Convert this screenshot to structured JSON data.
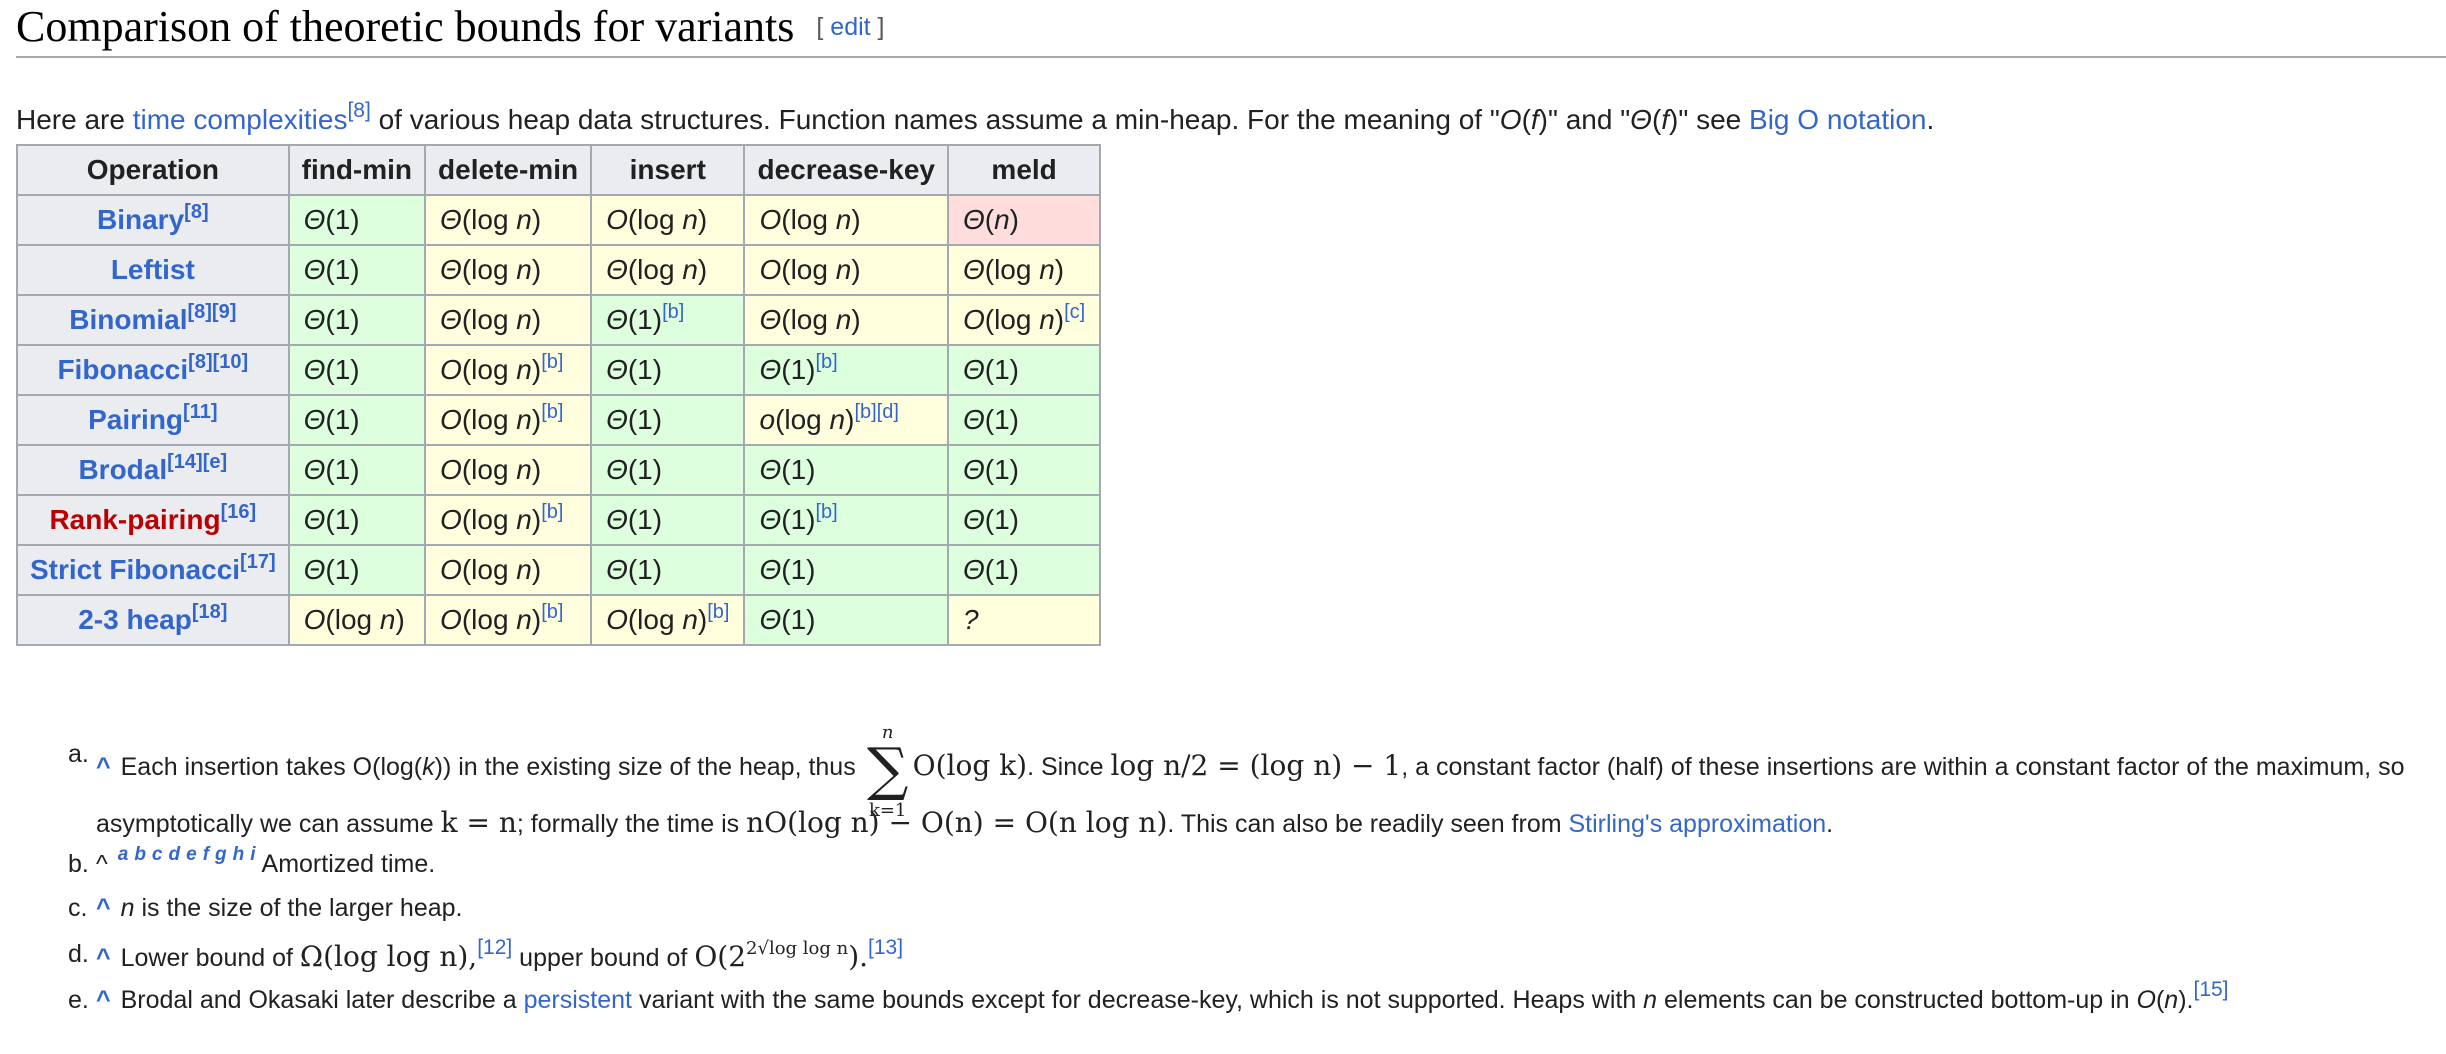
{
  "heading": {
    "title": "Comparison of theoretic bounds for variants",
    "edit_open": "[ ",
    "edit_label": "edit",
    "edit_close": " ]"
  },
  "intro": {
    "t1": "Here are ",
    "link1": "time complexities",
    "ref1": "[8]",
    "t2": " of various heap data structures. Function names assume a min-heap. For the meaning of \"",
    "o_f": "O",
    "paren_f1": "(",
    "f1": "f",
    "t3": ")\" and \"",
    "theta": "Θ",
    "paren_f2": "(",
    "f2": "f",
    "t4": ")\" see ",
    "link2": "Big O notation",
    "t5": "."
  },
  "table": {
    "headers": [
      "Operation",
      "find-min",
      "delete-min",
      "insert",
      "decrease-key",
      "meld"
    ],
    "rows": [
      {
        "name": "Binary",
        "refs": "[8]",
        "red": false,
        "cells": [
          [
            "Θ(1)",
            "",
            "good"
          ],
          [
            "Θ(log n)",
            "",
            "mid"
          ],
          [
            "O(log n)",
            "",
            "mid"
          ],
          [
            "O(log n)",
            "",
            "mid"
          ],
          [
            "Θ(n)",
            "",
            "bad"
          ]
        ]
      },
      {
        "name": "Leftist",
        "refs": "",
        "red": false,
        "cells": [
          [
            "Θ(1)",
            "",
            "good"
          ],
          [
            "Θ(log n)",
            "",
            "mid"
          ],
          [
            "Θ(log n)",
            "",
            "mid"
          ],
          [
            "O(log n)",
            "",
            "mid"
          ],
          [
            "Θ(log n)",
            "",
            "mid"
          ]
        ]
      },
      {
        "name": "Binomial",
        "refs": "[8][9]",
        "red": false,
        "cells": [
          [
            "Θ(1)",
            "",
            "good"
          ],
          [
            "Θ(log n)",
            "",
            "mid"
          ],
          [
            "Θ(1)",
            "[b]",
            "good"
          ],
          [
            "Θ(log n)",
            "",
            "mid"
          ],
          [
            "O(log n)",
            "[c]",
            "mid"
          ]
        ]
      },
      {
        "name": "Fibonacci",
        "refs": "[8][10]",
        "red": false,
        "cells": [
          [
            "Θ(1)",
            "",
            "good"
          ],
          [
            "O(log n)",
            "[b]",
            "mid"
          ],
          [
            "Θ(1)",
            "",
            "good"
          ],
          [
            "Θ(1)",
            "[b]",
            "good"
          ],
          [
            "Θ(1)",
            "",
            "good"
          ]
        ]
      },
      {
        "name": "Pairing",
        "refs": "[11]",
        "red": false,
        "cells": [
          [
            "Θ(1)",
            "",
            "good"
          ],
          [
            "O(log n)",
            "[b]",
            "mid"
          ],
          [
            "Θ(1)",
            "",
            "good"
          ],
          [
            "o(log n)",
            "[b][d]",
            "mid"
          ],
          [
            "Θ(1)",
            "",
            "good"
          ]
        ]
      },
      {
        "name": "Brodal",
        "refs": "[14][e]",
        "red": false,
        "cells": [
          [
            "Θ(1)",
            "",
            "good"
          ],
          [
            "O(log n)",
            "",
            "mid"
          ],
          [
            "Θ(1)",
            "",
            "good"
          ],
          [
            "Θ(1)",
            "",
            "good"
          ],
          [
            "Θ(1)",
            "",
            "good"
          ]
        ]
      },
      {
        "name": "Rank-pairing",
        "refs": "[16]",
        "red": true,
        "cells": [
          [
            "Θ(1)",
            "",
            "good"
          ],
          [
            "O(log n)",
            "[b]",
            "mid"
          ],
          [
            "Θ(1)",
            "",
            "good"
          ],
          [
            "Θ(1)",
            "[b]",
            "good"
          ],
          [
            "Θ(1)",
            "",
            "good"
          ]
        ]
      },
      {
        "name": "Strict Fibonacci",
        "refs": "[17]",
        "red": false,
        "cells": [
          [
            "Θ(1)",
            "",
            "good"
          ],
          [
            "O(log n)",
            "",
            "mid"
          ],
          [
            "Θ(1)",
            "",
            "good"
          ],
          [
            "Θ(1)",
            "",
            "good"
          ],
          [
            "Θ(1)",
            "",
            "good"
          ]
        ]
      },
      {
        "name": "2-3 heap",
        "refs": "[18]",
        "red": false,
        "cells": [
          [
            "O(log n)",
            "",
            "mid"
          ],
          [
            "O(log n)",
            "[b]",
            "mid"
          ],
          [
            "O(log n)",
            "[b]",
            "mid"
          ],
          [
            "Θ(1)",
            "",
            "good"
          ],
          [
            "?",
            "",
            "mid"
          ]
        ]
      }
    ]
  },
  "notes": {
    "a": {
      "label": "a.",
      "caret": "^",
      "t1": "Each insertion takes O(log(",
      "k1": "k",
      "t2": ")) in the existing size of the heap, thus",
      "sum_upper": "n",
      "sum_sigma": "∑",
      "sum_lower": "k=1",
      "m1": "O(log k)",
      "t3": ". Since ",
      "m2": "log n/2 = (log n) − 1",
      "t4": ", a constant factor (half) of these insertions are within a constant factor of the maximum, so",
      "l2_t1": "asymptotically we can assume ",
      "m3": "k = n",
      "l2_t2": "; formally the time is ",
      "m4": "nO(log n) − O(n) = O(n log n)",
      "l2_t3": ". This can also be readily seen from ",
      "link": "Stirling's approximation",
      "l2_t4": "."
    },
    "b": {
      "label": "b.",
      "caret": "^",
      "letters": [
        "a",
        "b",
        "c",
        "d",
        "e",
        "f",
        "g",
        "h",
        "i"
      ],
      "text": "Amortized time."
    },
    "c": {
      "label": "c.",
      "caret": "^",
      "n": "n",
      "text": " is the size of the larger heap."
    },
    "d": {
      "label": "d.",
      "caret": "^",
      "t1": "Lower bound of ",
      "m1": "Ω(log log n),",
      "ref1": "[12]",
      "t2": " upper bound of ",
      "m2a": "O(2",
      "m2sup": "2√log log n",
      "m2b": ").",
      "ref2": "[13]"
    },
    "e": {
      "label": "e.",
      "caret": "^",
      "t1": "Brodal and Okasaki later describe a ",
      "link": "persistent",
      "t2": " variant with the same bounds except for decrease-key, which is not supported. Heaps with ",
      "n": "n",
      "t3": " elements can be constructed bottom-up in ",
      "oi": "O",
      "t4": "(",
      "ni": "n",
      "t5": ").",
      "ref": "[15]"
    }
  }
}
